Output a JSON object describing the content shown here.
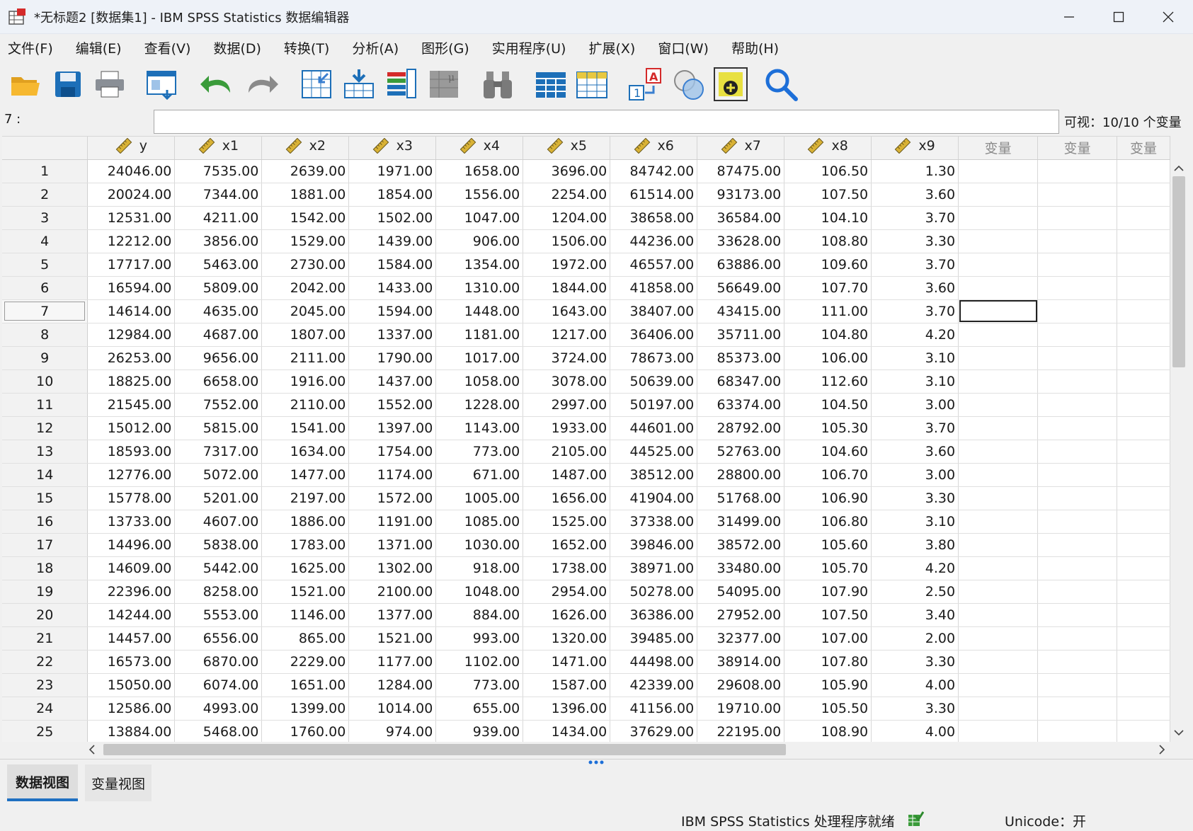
{
  "window": {
    "title": "*无标题2 [数据集1] - IBM SPSS Statistics 数据编辑器"
  },
  "menu": [
    "文件(F)",
    "编辑(E)",
    "查看(V)",
    "数据(D)",
    "转换(T)",
    "分析(A)",
    "图形(G)",
    "实用程序(U)",
    "扩展(X)",
    "窗口(W)",
    "帮助(H)"
  ],
  "toolbar": {
    "icons": [
      "open-folder-icon",
      "save-icon",
      "print-icon",
      "recall-dialog-icon",
      "undo-icon",
      "redo-icon",
      "goto-case-icon",
      "goto-variable-icon",
      "variables-icon",
      "descriptive-stats-icon",
      "find-icon",
      "insert-cases-icon",
      "insert-variable-icon",
      "split-file-icon",
      "select-cases-icon",
      "value-labels-icon",
      "use-sets-icon",
      "search-icon"
    ]
  },
  "cell_editor": {
    "ref": "7 :",
    "value": "",
    "visible_vars": "可视：10/10 个变量"
  },
  "grid": {
    "columns": [
      "y",
      "x1",
      "x2",
      "x3",
      "x4",
      "x5",
      "x6",
      "x7",
      "x8",
      "x9"
    ],
    "empty_columns": [
      "变量",
      "变量",
      "变量"
    ],
    "active_row": 7,
    "rows": [
      [
        "24046.00",
        "7535.00",
        "2639.00",
        "1971.00",
        "1658.00",
        "3696.00",
        "84742.00",
        "87475.00",
        "106.50",
        "1.30"
      ],
      [
        "20024.00",
        "7344.00",
        "1881.00",
        "1854.00",
        "1556.00",
        "2254.00",
        "61514.00",
        "93173.00",
        "107.50",
        "3.60"
      ],
      [
        "12531.00",
        "4211.00",
        "1542.00",
        "1502.00",
        "1047.00",
        "1204.00",
        "38658.00",
        "36584.00",
        "104.10",
        "3.70"
      ],
      [
        "12212.00",
        "3856.00",
        "1529.00",
        "1439.00",
        "906.00",
        "1506.00",
        "44236.00",
        "33628.00",
        "108.80",
        "3.30"
      ],
      [
        "17717.00",
        "5463.00",
        "2730.00",
        "1584.00",
        "1354.00",
        "1972.00",
        "46557.00",
        "63886.00",
        "109.60",
        "3.70"
      ],
      [
        "16594.00",
        "5809.00",
        "2042.00",
        "1433.00",
        "1310.00",
        "1844.00",
        "41858.00",
        "56649.00",
        "107.70",
        "3.60"
      ],
      [
        "14614.00",
        "4635.00",
        "2045.00",
        "1594.00",
        "1448.00",
        "1643.00",
        "38407.00",
        "43415.00",
        "111.00",
        "3.70"
      ],
      [
        "12984.00",
        "4687.00",
        "1807.00",
        "1337.00",
        "1181.00",
        "1217.00",
        "36406.00",
        "35711.00",
        "104.80",
        "4.20"
      ],
      [
        "26253.00",
        "9656.00",
        "2111.00",
        "1790.00",
        "1017.00",
        "3724.00",
        "78673.00",
        "85373.00",
        "106.00",
        "3.10"
      ],
      [
        "18825.00",
        "6658.00",
        "1916.00",
        "1437.00",
        "1058.00",
        "3078.00",
        "50639.00",
        "68347.00",
        "112.60",
        "3.10"
      ],
      [
        "21545.00",
        "7552.00",
        "2110.00",
        "1552.00",
        "1228.00",
        "2997.00",
        "50197.00",
        "63374.00",
        "104.50",
        "3.00"
      ],
      [
        "15012.00",
        "5815.00",
        "1541.00",
        "1397.00",
        "1143.00",
        "1933.00",
        "44601.00",
        "28792.00",
        "105.30",
        "3.70"
      ],
      [
        "18593.00",
        "7317.00",
        "1634.00",
        "1754.00",
        "773.00",
        "2105.00",
        "44525.00",
        "52763.00",
        "104.60",
        "3.60"
      ],
      [
        "12776.00",
        "5072.00",
        "1477.00",
        "1174.00",
        "671.00",
        "1487.00",
        "38512.00",
        "28800.00",
        "106.70",
        "3.00"
      ],
      [
        "15778.00",
        "5201.00",
        "2197.00",
        "1572.00",
        "1005.00",
        "1656.00",
        "41904.00",
        "51768.00",
        "106.90",
        "3.30"
      ],
      [
        "13733.00",
        "4607.00",
        "1886.00",
        "1191.00",
        "1085.00",
        "1525.00",
        "37338.00",
        "31499.00",
        "106.80",
        "3.10"
      ],
      [
        "14496.00",
        "5838.00",
        "1783.00",
        "1371.00",
        "1030.00",
        "1652.00",
        "39846.00",
        "38572.00",
        "105.60",
        "3.80"
      ],
      [
        "14609.00",
        "5442.00",
        "1625.00",
        "1302.00",
        "918.00",
        "1738.00",
        "38971.00",
        "33480.00",
        "105.70",
        "4.20"
      ],
      [
        "22396.00",
        "8258.00",
        "1521.00",
        "2100.00",
        "1048.00",
        "2954.00",
        "50278.00",
        "54095.00",
        "107.90",
        "2.50"
      ],
      [
        "14244.00",
        "5553.00",
        "1146.00",
        "1377.00",
        "884.00",
        "1626.00",
        "36386.00",
        "27952.00",
        "107.50",
        "3.40"
      ],
      [
        "14457.00",
        "6556.00",
        "865.00",
        "1521.00",
        "993.00",
        "1320.00",
        "39485.00",
        "32377.00",
        "107.00",
        "2.00"
      ],
      [
        "16573.00",
        "6870.00",
        "2229.00",
        "1177.00",
        "1102.00",
        "1471.00",
        "44498.00",
        "38914.00",
        "107.80",
        "3.30"
      ],
      [
        "15050.00",
        "6074.00",
        "1651.00",
        "1284.00",
        "773.00",
        "1587.00",
        "42339.00",
        "29608.00",
        "105.90",
        "4.00"
      ],
      [
        "12586.00",
        "4993.00",
        "1399.00",
        "1014.00",
        "655.00",
        "1396.00",
        "41156.00",
        "19710.00",
        "105.50",
        "3.30"
      ],
      [
        "13884.00",
        "5468.00",
        "1760.00",
        "974.00",
        "939.00",
        "1434.00",
        "37629.00",
        "22195.00",
        "108.90",
        "4.00"
      ]
    ]
  },
  "tabs": {
    "data_view": "数据视图",
    "variable_view": "变量视图"
  },
  "status": {
    "processor": "IBM SPSS Statistics 处理程序就绪",
    "unicode": "Unicode：开"
  },
  "colors": {
    "accent": "#1f70c1",
    "grid_header": "#f2f2f2",
    "scale_icon": "#c9a227"
  }
}
